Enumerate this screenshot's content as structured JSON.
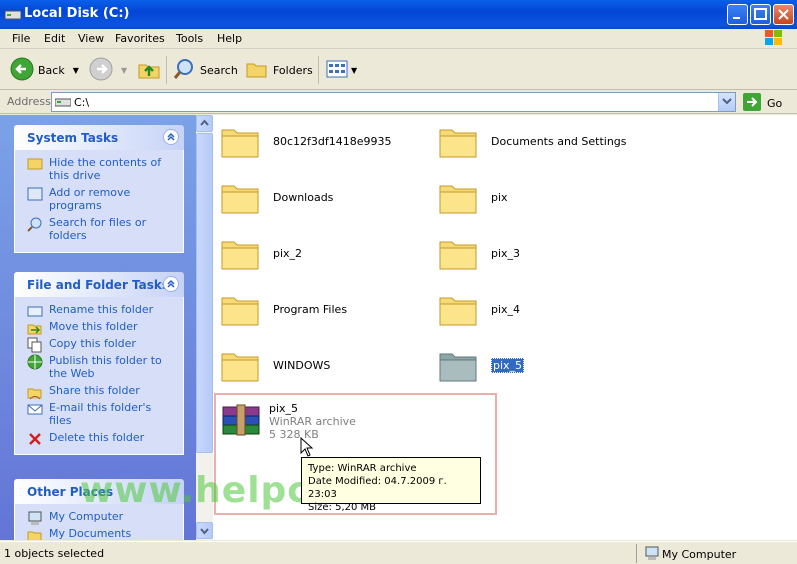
{
  "window": {
    "title": "Local Disk (C:)"
  },
  "menu": [
    "File",
    "Edit",
    "View",
    "Favorites",
    "Tools",
    "Help"
  ],
  "toolbar": {
    "back": "Back",
    "search": "Search",
    "folders": "Folders"
  },
  "address": {
    "label": "Address",
    "value": "C:\\",
    "go": "Go"
  },
  "left_pane": {
    "system_tasks": {
      "title": "System Tasks",
      "items": [
        "Hide the contents of this drive",
        "Add or remove programs",
        "Search for files or folders"
      ]
    },
    "file_folder_tasks": {
      "title": "File and Folder Tasks",
      "items": [
        "Rename this folder",
        "Move this folder",
        "Copy this folder",
        "Publish this folder to the Web",
        "Share this folder",
        "E-mail this folder's files",
        "Delete this folder"
      ]
    },
    "other_places": {
      "title": "Other Places",
      "items": [
        "My Computer",
        "My Documents"
      ]
    }
  },
  "files": [
    {
      "name": "80c12f3df1418e9935",
      "type": "folder"
    },
    {
      "name": "Documents and Settings",
      "type": "folder"
    },
    {
      "name": "Downloads",
      "type": "folder"
    },
    {
      "name": "pix",
      "type": "folder"
    },
    {
      "name": "pix_2",
      "type": "folder"
    },
    {
      "name": "pix_3",
      "type": "folder"
    },
    {
      "name": "Program Files",
      "type": "folder"
    },
    {
      "name": "pix_4",
      "type": "folder"
    },
    {
      "name": "WINDOWS",
      "type": "folder"
    },
    {
      "name": "pix_5",
      "type": "folder-selected"
    }
  ],
  "archive": {
    "name": "pix_5",
    "type_label": "WinRAR archive",
    "size": "5 328 KB"
  },
  "tooltip": {
    "type": "Type: WinRAR archive",
    "modified": "Date Modified: 04.7.2009 г. 23:03",
    "size": "Size: 5,20 MB"
  },
  "watermark": "www.helpcho.com",
  "status": {
    "left": "1 objects selected",
    "right": "My Computer"
  }
}
